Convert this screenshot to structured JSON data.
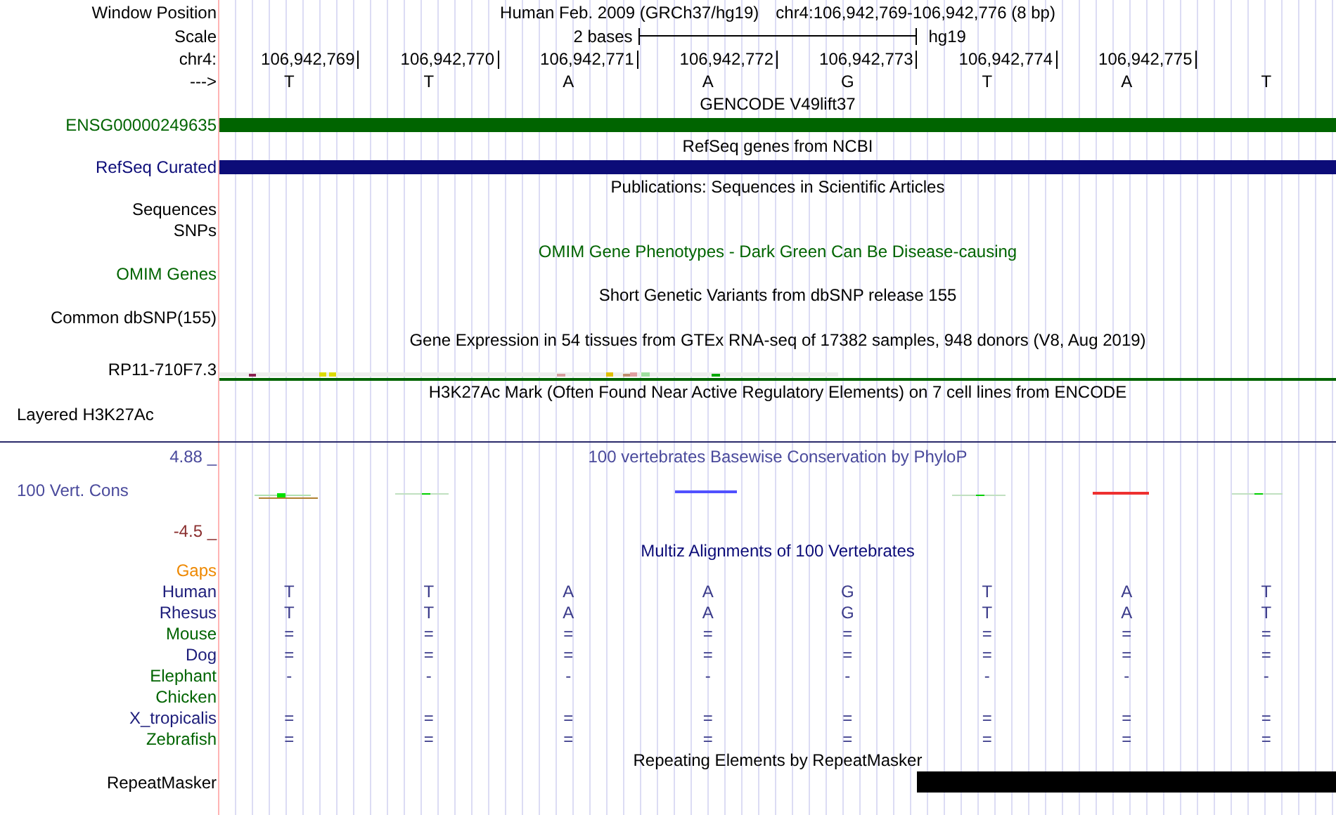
{
  "header": {
    "window_label": "Window Position",
    "assembly": "Human Feb. 2009 (GRCh37/hg19)",
    "position": "chr4:106,942,769-106,942,776 (8 bp)",
    "scale_label": "Scale",
    "scale_text": "2 bases",
    "scale_db": "hg19",
    "ruler_label": "chr4:",
    "ticks": [
      "106,942,769",
      "106,942,770",
      "106,942,771",
      "106,942,772",
      "106,942,773",
      "106,942,774",
      "106,942,775"
    ],
    "strand_label": "--->",
    "bases": [
      "T",
      "T",
      "A",
      "A",
      "G",
      "T",
      "A",
      "T"
    ]
  },
  "tracks": [
    {
      "kind": "gene",
      "title": "GENCODE V49lift37",
      "label": "ENSG00000249635",
      "color": "#006400"
    },
    {
      "kind": "gene",
      "title": "RefSeq genes from NCBI",
      "label": "RefSeq Curated",
      "color": "#0c0c78"
    },
    {
      "kind": "empty",
      "title": "Publications: Sequences in Scientific Articles",
      "labels": [
        "Sequences",
        "SNPs"
      ],
      "color": "#000000"
    },
    {
      "kind": "empty",
      "title": "OMIM Gene Phenotypes - Dark Green Can Be Disease-causing",
      "labels": [
        "OMIM Genes"
      ],
      "color": "#006400"
    },
    {
      "kind": "empty",
      "title": "Short Genetic Variants from dbSNP release 155",
      "labels": [
        "Common dbSNP(155)"
      ],
      "color": "#000000"
    },
    {
      "kind": "expression",
      "title": "Gene Expression in 54 tissues from GTEx RNA-seq of 17382 samples, 948 donors (V8, Aug 2019)",
      "label": "RP11-710F7.3",
      "color": "#000000"
    },
    {
      "kind": "layered",
      "title": "H3K27Ac Mark (Often Found Near Active Regulatory Elements) on 7 cell lines from ENCODE",
      "label": "Layered H3K27Ac",
      "color": "#000000"
    },
    {
      "kind": "wiggle",
      "title": "100 vertebrates Basewise Conservation by PhyloP",
      "label": "100 Vert. Cons",
      "max": "4.88 _",
      "min": "-4.5 _",
      "color": "#4a4a9c"
    },
    {
      "kind": "alignment",
      "title": "Multiz Alignments of 100 Vertebrates",
      "gaps_label": "Gaps",
      "color": "#0c0c78",
      "species": [
        {
          "name": "Human",
          "color": "#1c1c7a",
          "bases": [
            "T",
            "T",
            "A",
            "A",
            "G",
            "T",
            "A",
            "T"
          ]
        },
        {
          "name": "Rhesus",
          "color": "#1c1c7a",
          "bases": [
            "T",
            "T",
            "A",
            "A",
            "G",
            "T",
            "A",
            "T"
          ]
        },
        {
          "name": "Mouse",
          "color": "#006400",
          "bases": [
            "=",
            "=",
            "=",
            "=",
            "=",
            "=",
            "=",
            "="
          ]
        },
        {
          "name": "Dog",
          "color": "#1c1c7a",
          "bases": [
            "=",
            "=",
            "=",
            "=",
            "=",
            "=",
            "=",
            "="
          ]
        },
        {
          "name": "Elephant",
          "color": "#006400",
          "bases": [
            "-",
            "-",
            "-",
            "-",
            "-",
            "-",
            "-",
            "-"
          ]
        },
        {
          "name": "Chicken",
          "color": "#006400"
        },
        {
          "name": "X_tropicalis",
          "color": "#1c1c7a",
          "bases": [
            "=",
            "=",
            "=",
            "=",
            "=",
            "=",
            "=",
            "="
          ]
        },
        {
          "name": "Zebrafish",
          "color": "#006400",
          "bases": [
            "=",
            "=",
            "=",
            "=",
            "=",
            "=",
            "=",
            "="
          ]
        }
      ]
    },
    {
      "kind": "repeat",
      "title": "Repeating Elements by RepeatMasker",
      "label": "RepeatMasker",
      "color": "#000000",
      "masked": [
        false,
        false,
        false,
        false,
        false,
        true,
        true,
        true
      ]
    }
  ]
}
